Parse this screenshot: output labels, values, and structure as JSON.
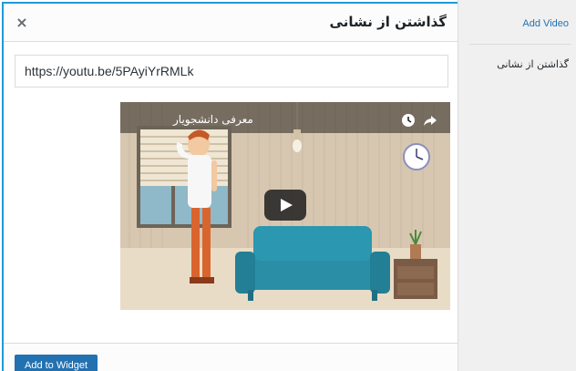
{
  "modal": {
    "title": "گذاشتن از نشانی",
    "close_glyph": "×",
    "url_value": "https://youtu.be/5PAyiYrRMLk",
    "footer_button": "Add to Widget"
  },
  "video": {
    "title": "معرفی دانشجویار",
    "icons": [
      "clock-icon",
      "share-icon",
      "play-icon"
    ]
  },
  "sidebar": {
    "link": "Add Video",
    "item": "گذاشتن از نشانی"
  },
  "colors": {
    "accent": "#1e9bd6",
    "button": "#2271b1",
    "sofa": "#2a8ea6",
    "wall": "#d9cbb6"
  }
}
